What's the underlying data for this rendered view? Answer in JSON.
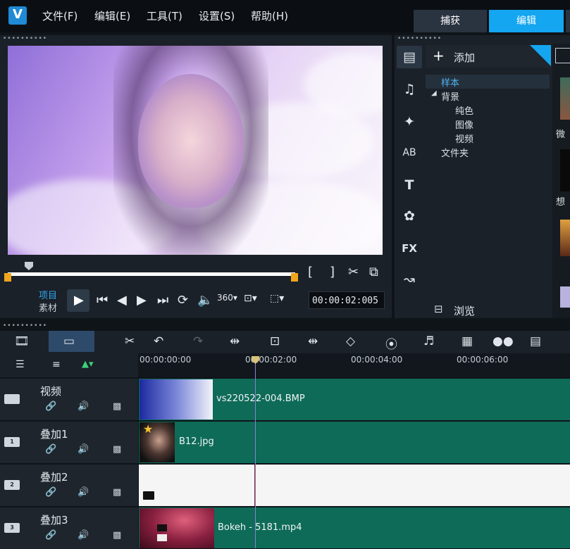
{
  "app": {
    "logo": "V"
  },
  "menu": [
    {
      "label": "文件(F)"
    },
    {
      "label": "编辑(E)"
    },
    {
      "label": "工具(T)"
    },
    {
      "label": "设置(S)"
    },
    {
      "label": "帮助(H)"
    }
  ],
  "tabs": {
    "capture": "捕获",
    "edit": "编辑"
  },
  "player": {
    "project_label": "项目",
    "clip_label": "素材",
    "timecode": "00:00:02:005"
  },
  "library": {
    "add_label": "添加",
    "tree": [
      {
        "label": "样本",
        "selected": true
      },
      {
        "label": "背景",
        "expanded": true
      },
      {
        "label": "纯色"
      },
      {
        "label": "图像"
      },
      {
        "label": "视频"
      },
      {
        "label": "文件夹"
      }
    ],
    "browse_label": "浏览",
    "thumb_labels": [
      "微",
      "想"
    ]
  },
  "timeline": {
    "ruler": [
      "00:00:00:00",
      "00:00:02:00",
      "00:00:04:00",
      "00:00:06:00"
    ],
    "tracks": [
      {
        "name": "视频",
        "badge": "",
        "clip": "vs220522-004.BMP"
      },
      {
        "name": "叠加1",
        "badge": "1",
        "clip": "B12.jpg"
      },
      {
        "name": "叠加2",
        "badge": "2",
        "clip": ""
      },
      {
        "name": "叠加3",
        "badge": "3",
        "clip": "Bokeh - 5181.mp4"
      }
    ]
  },
  "colors": {
    "accent": "#14a6f0",
    "track": "#0e6b58",
    "marker": "#f0a51c"
  }
}
